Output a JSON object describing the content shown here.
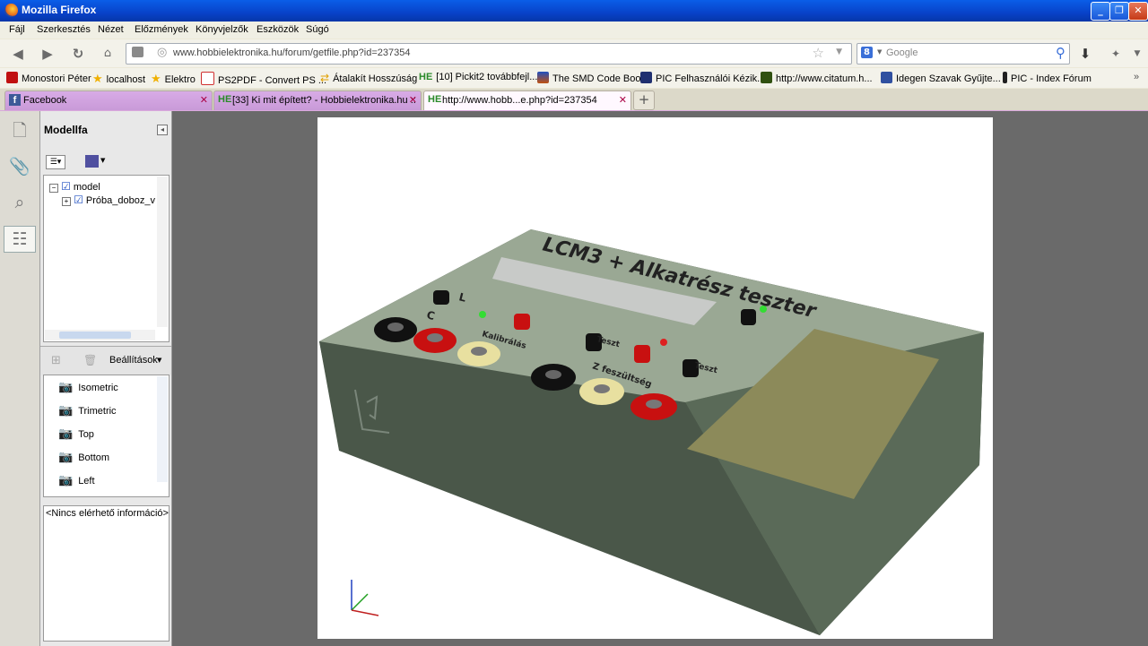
{
  "window": {
    "title": "Mozilla Firefox"
  },
  "menu": [
    "Fájl",
    "Szerkesztés",
    "Nézet",
    "Előzmények",
    "Könyvjelzők",
    "Eszközök",
    "Súgó"
  ],
  "nav": {
    "url": "www.hobbielektronika.hu/forum/getfile.php?id=237354",
    "search_placeholder": "Google"
  },
  "bookmarks": [
    {
      "label": "Monostori Péter",
      "color": "#c01010"
    },
    {
      "label": "localhost",
      "color": "#f0b000"
    },
    {
      "label": "Elektro",
      "color": "#f0b000"
    },
    {
      "label": "PS2PDF - Convert PS ...",
      "color": "#d03030"
    },
    {
      "label": "Átalakít Hosszúság",
      "color": "#e0a000"
    },
    {
      "label": "[10] Pickit2 továbbfejl...",
      "color": "#2a8a2a"
    },
    {
      "label": "The SMD Code Book",
      "color": "#a04020"
    },
    {
      "label": "PIC Felhasználói Kézik...",
      "color": "#203070"
    },
    {
      "label": "http://www.citatum.h...",
      "color": "#305010"
    },
    {
      "label": "Idegen Szavak Gyűjte...",
      "color": "#3050a0"
    },
    {
      "label": "PIC - Index Fórum",
      "color": "#202020"
    }
  ],
  "tabs": [
    {
      "label": "Facebook"
    },
    {
      "label": "[33] Ki mit épített? - Hobbielektronika.hu ::"
    },
    {
      "label": "http://www.hobb...e.php?id=237354"
    }
  ],
  "panel": {
    "title": "Modellfa",
    "tree": [
      "model",
      "Próba_doboz_v"
    ],
    "settings_label": "Beállítások",
    "views": [
      "Isometric",
      "Trimetric",
      "Top",
      "Bottom",
      "Left"
    ],
    "info": "<Nincs elérhető információ>"
  },
  "model": {
    "title": "LCM3 + Alkatrész teszter",
    "labels": {
      "l": "L",
      "c": "C",
      "calib": "Kalibrálás",
      "teszt1": "Teszt",
      "zener": "Z feszültség",
      "teszt2": "Teszt"
    }
  }
}
